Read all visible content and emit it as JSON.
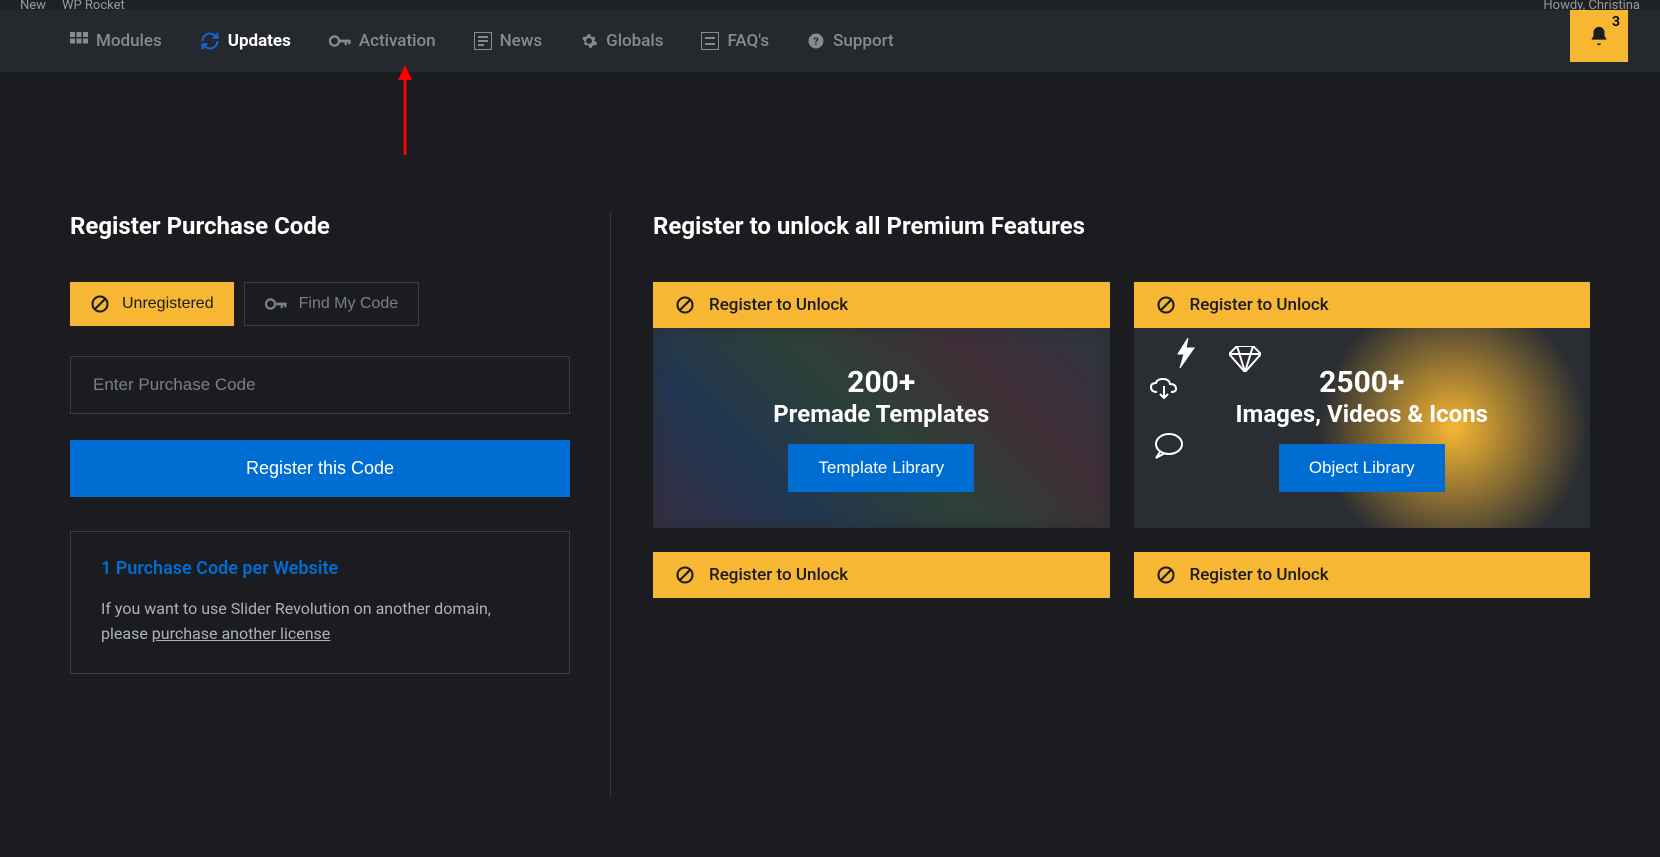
{
  "topbar": {
    "new": "New",
    "plugin": "WP Rocket",
    "howdy": "Howdy, Christina"
  },
  "nav": {
    "items": [
      {
        "label": "Modules",
        "icon": "modules"
      },
      {
        "label": "Updates",
        "icon": "refresh",
        "active": true
      },
      {
        "label": "Activation",
        "icon": "key"
      },
      {
        "label": "News",
        "icon": "news"
      },
      {
        "label": "Globals",
        "icon": "gear"
      },
      {
        "label": "FAQ's",
        "icon": "faq"
      },
      {
        "label": "Support",
        "icon": "help"
      }
    ],
    "notif_count": "3"
  },
  "register": {
    "heading": "Register Purchase Code",
    "unregistered": "Unregistered",
    "find_code": "Find My Code",
    "placeholder": "Enter Purchase Code",
    "button": "Register this Code",
    "info_title": "1 Purchase Code per Website",
    "info_text_pre": "If you want to use Slider Revolution on another domain, please ",
    "info_link": "purchase another license"
  },
  "features": {
    "heading": "Register to unlock all Premium Features",
    "unlock_label": "Register to Unlock",
    "cards": [
      {
        "stat": "200+",
        "title": "Premade Templates",
        "button": "Template Library"
      },
      {
        "stat": "2500+",
        "title": "Images, Videos & Icons",
        "button": "Object Library"
      }
    ]
  }
}
